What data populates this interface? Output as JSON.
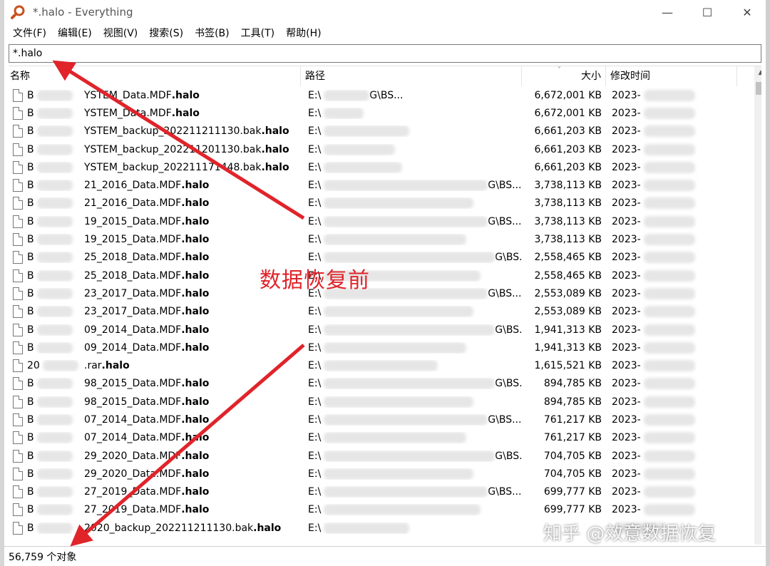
{
  "window": {
    "title": "*.halo - Everything",
    "minimize_glyph": "—",
    "maximize_glyph": "☐",
    "close_glyph": "✕"
  },
  "menu": [
    "文件(F)",
    "编辑(E)",
    "视图(V)",
    "搜索(S)",
    "书签(B)",
    "工具(T)",
    "帮助(H)"
  ],
  "search": {
    "value": "*.halo"
  },
  "columns": {
    "name": "名称",
    "path": "路径",
    "size": "大小",
    "modified": "修改时间"
  },
  "rows": [
    {
      "pre": "B",
      "name": "YSTEM_Data.MDF",
      "ext": ".halo",
      "path": "E:\\",
      "path_end": "G\\BS...",
      "size": "6,672,001 KB",
      "modified": "2023-"
    },
    {
      "pre": "B",
      "name": "YSTEM_Data.MDF",
      "ext": ".halo",
      "path": "E:\\",
      "path_end": "",
      "size": "6,672,001 KB",
      "modified": "2023-"
    },
    {
      "pre": "B",
      "name": "YSTEM_backup_202211211130.bak",
      "ext": ".halo",
      "path": "E:\\",
      "path_end": "",
      "size": "6,661,203 KB",
      "modified": "2023-"
    },
    {
      "pre": "B",
      "name": "YSTEM_backup_202211201130.bak",
      "ext": ".halo",
      "path": "E:\\",
      "path_end": "",
      "size": "6,661,203 KB",
      "modified": "2023-"
    },
    {
      "pre": "B",
      "name": "YSTEM_backup_202211171448.bak",
      "ext": ".halo",
      "path": "E:\\",
      "path_end": "",
      "size": "6,661,203 KB",
      "modified": "2023-"
    },
    {
      "pre": "B",
      "name": "21_2016_Data.MDF",
      "ext": ".halo",
      "path": "E:\\",
      "path_end": "G\\BS...",
      "size": "3,738,113 KB",
      "modified": "2023-"
    },
    {
      "pre": "B",
      "name": "21_2016_Data.MDF",
      "ext": ".halo",
      "path": "E:\\",
      "path_end": "",
      "size": "3,738,113 KB",
      "modified": "2023-"
    },
    {
      "pre": "B",
      "name": "19_2015_Data.MDF",
      "ext": ".halo",
      "path": "E:\\",
      "path_end": "G\\BS...",
      "size": "3,738,113 KB",
      "modified": "2023-"
    },
    {
      "pre": "B",
      "name": "19_2015_Data.MDF",
      "ext": ".halo",
      "path": "E:\\",
      "path_end": "",
      "size": "3,738,113 KB",
      "modified": "2023-"
    },
    {
      "pre": "B",
      "name": "25_2018_Data.MDF",
      "ext": ".halo",
      "path": "E:\\",
      "path_end": "G\\BS...",
      "size": "2,558,465 KB",
      "modified": "2023-"
    },
    {
      "pre": "B",
      "name": "25_2018_Data.MDF",
      "ext": ".halo",
      "path": "E:\\",
      "path_end": "",
      "size": "2,558,465 KB",
      "modified": "2023-"
    },
    {
      "pre": "B",
      "name": "23_2017_Data.MDF",
      "ext": ".halo",
      "path": "E:\\",
      "path_end": "G\\BS...",
      "size": "2,553,089 KB",
      "modified": "2023-"
    },
    {
      "pre": "B",
      "name": "23_2017_Data.MDF",
      "ext": ".halo",
      "path": "E:\\",
      "path_end": "",
      "size": "2,553,089 KB",
      "modified": "2023-"
    },
    {
      "pre": "B",
      "name": "09_2014_Data.MDF",
      "ext": ".halo",
      "path": "E:\\",
      "path_end": "G\\BS...",
      "size": "1,941,313 KB",
      "modified": "2023-"
    },
    {
      "pre": "B",
      "name": "09_2014_Data.MDF",
      "ext": ".halo",
      "path": "E:\\",
      "path_end": "",
      "size": "1,941,313 KB",
      "modified": "2023-"
    },
    {
      "pre": "20",
      "name": ".rar",
      "ext": ".halo",
      "path": "E:\\",
      "path_end": "",
      "size": "1,615,521 KB",
      "modified": "2023-"
    },
    {
      "pre": "B",
      "name": "98_2015_Data.MDF",
      "ext": ".halo",
      "path": "E:\\",
      "path_end": "G\\BS...",
      "size": "894,785 KB",
      "modified": "2023-"
    },
    {
      "pre": "B",
      "name": "98_2015_Data.MDF",
      "ext": ".halo",
      "path": "E:\\",
      "path_end": "",
      "size": "894,785 KB",
      "modified": "2023-"
    },
    {
      "pre": "B",
      "name": "07_2014_Data.MDF",
      "ext": ".halo",
      "path": "E:\\",
      "path_end": "G\\BS...",
      "size": "761,217 KB",
      "modified": "2023-"
    },
    {
      "pre": "B",
      "name": "07_2014_Data.MDF",
      "ext": ".halo",
      "path": "E:\\",
      "path_end": "",
      "size": "761,217 KB",
      "modified": "2023-"
    },
    {
      "pre": "B",
      "name": "29_2020_Data.MDF",
      "ext": ".halo",
      "path": "E:\\",
      "path_end": "G\\BS...",
      "size": "704,705 KB",
      "modified": "2023-"
    },
    {
      "pre": "B",
      "name": "29_2020_Data.MDF",
      "ext": ".halo",
      "path": "E:\\",
      "path_end": "",
      "size": "704,705 KB",
      "modified": "2023-"
    },
    {
      "pre": "B",
      "name": "27_2019_Data.MDF",
      "ext": ".halo",
      "path": "E:\\",
      "path_end": "G\\BS...",
      "size": "699,777 KB",
      "modified": "2023-"
    },
    {
      "pre": "B",
      "name": "27_2019_Data.MDF",
      "ext": ".halo",
      "path": "E:\\",
      "path_end": "",
      "size": "699,777 KB",
      "modified": "2023-"
    },
    {
      "pre": "B",
      "name": "2020_backup_202211211130.bak",
      "ext": ".halo",
      "path": "E:\\",
      "path_end": "",
      "size": "",
      "modified": ""
    }
  ],
  "status": {
    "text": "56,759 个对象"
  },
  "annotation": {
    "text": "数据恢复前",
    "color": "#e0242a"
  },
  "watermark": {
    "text": "知乎 @效意数据恢复"
  },
  "colors": {
    "arrow": "#e0242a"
  }
}
